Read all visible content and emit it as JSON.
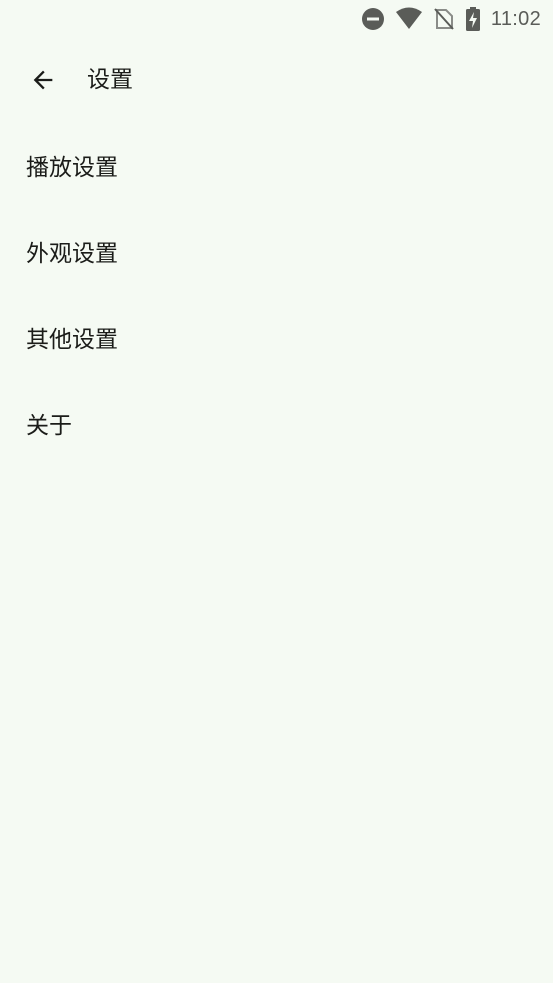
{
  "status_bar": {
    "time": "11:02",
    "icons": [
      "do-not-disturb-icon",
      "wifi-icon",
      "no-sim-icon",
      "battery-charging-icon"
    ]
  },
  "top_bar": {
    "back_icon": "arrow-back-icon",
    "title": "设置"
  },
  "settings": {
    "items": [
      {
        "label": "播放设置"
      },
      {
        "label": "外观设置"
      },
      {
        "label": "其他设置"
      },
      {
        "label": "关于"
      }
    ]
  },
  "colors": {
    "background": "#f5faf3",
    "text": "#1b1c19",
    "status_icons": "#5a5c58"
  }
}
